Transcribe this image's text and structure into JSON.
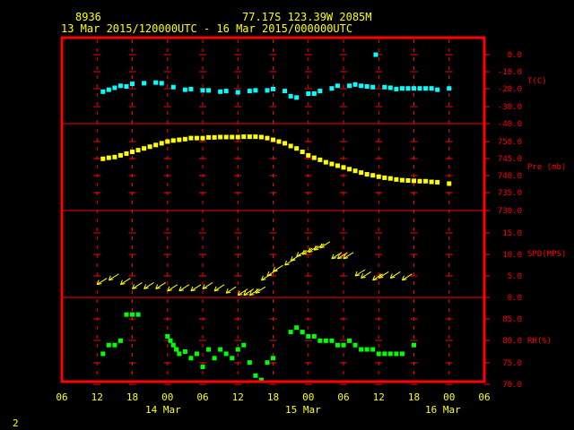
{
  "header": {
    "station_id": "8936",
    "location": "77.17S  123.39W  2085M",
    "time_range": "13 Mar 2015/120000UTC - 16 Mar 2015/000000UTC"
  },
  "page_number": "2",
  "colors": {
    "background": "#000000",
    "frame": "#ff0000",
    "header_text": "#ffff00",
    "temperature": "#00ffff",
    "pressure": "#ffff00",
    "wind": "#ffff00",
    "rh": "#00ff00"
  },
  "x_axis": {
    "tick_labels": [
      "06",
      "12",
      "18",
      "00",
      "06",
      "12",
      "18",
      "00",
      "06",
      "12",
      "18",
      "00",
      "06"
    ],
    "date_labels": [
      "14 Mar",
      "15 Mar",
      "16 Mar"
    ],
    "range_hours": [
      -6,
      66
    ],
    "note_origin": "13 Mar 2015 12UTC = hour 0"
  },
  "chart_data": [
    {
      "type": "scatter",
      "panel": "temperature",
      "ylabel": "T(C)",
      "yticks": [
        "0.0",
        "-10.0",
        "-20.0",
        "-30.0",
        "-40.0"
      ],
      "ylim": [
        -40,
        5
      ],
      "points": [
        {
          "x": 1,
          "y": -28.5
        },
        {
          "x": 2,
          "y": -27
        },
        {
          "x": 3,
          "y": -25.5
        },
        {
          "x": 4,
          "y": -24
        },
        {
          "x": 5,
          "y": -24.5
        },
        {
          "x": 6,
          "y": -22.5
        },
        {
          "x": 8,
          "y": -22
        },
        {
          "x": 10,
          "y": -21.5
        },
        {
          "x": 11,
          "y": -22
        },
        {
          "x": 13,
          "y": -25
        },
        {
          "x": 15,
          "y": -27
        },
        {
          "x": 16,
          "y": -26.5
        },
        {
          "x": 18,
          "y": -27.5
        },
        {
          "x": 19,
          "y": -27.5
        },
        {
          "x": 21,
          "y": -28.5
        },
        {
          "x": 22,
          "y": -28
        },
        {
          "x": 24,
          "y": -29
        },
        {
          "x": 26,
          "y": -28
        },
        {
          "x": 27,
          "y": -27.5
        },
        {
          "x": 29,
          "y": -27.5
        },
        {
          "x": 30,
          "y": -26.5
        },
        {
          "x": 32,
          "y": -28
        },
        {
          "x": 33,
          "y": -32
        },
        {
          "x": 34,
          "y": -33
        },
        {
          "x": 36,
          "y": -30
        },
        {
          "x": 37,
          "y": -30
        },
        {
          "x": 38,
          "y": -28
        },
        {
          "x": 40,
          "y": -26
        },
        {
          "x": 41,
          "y": -24
        },
        {
          "x": 43,
          "y": -24
        },
        {
          "x": 44,
          "y": -23
        },
        {
          "x": 45,
          "y": -24
        },
        {
          "x": 46,
          "y": -24.5
        },
        {
          "x": 47,
          "y": -25
        },
        {
          "x": 49,
          "y": -25
        },
        {
          "x": 50,
          "y": -25.5
        },
        {
          "x": 51,
          "y": -26.5
        },
        {
          "x": 52,
          "y": -26
        },
        {
          "x": 53,
          "y": -26
        },
        {
          "x": 54,
          "y": -26
        },
        {
          "x": 55,
          "y": -26
        },
        {
          "x": 56,
          "y": -26
        },
        {
          "x": 57,
          "y": -26
        },
        {
          "x": 58,
          "y": -27
        },
        {
          "x": 60,
          "y": -26
        },
        {
          "x": 47.5,
          "y": 0
        }
      ]
    },
    {
      "type": "scatter",
      "panel": "pressure",
      "ylabel": "Pre (mb)",
      "yticks": [
        "750.0",
        "745.0",
        "740.0",
        "735.0",
        "730.0"
      ],
      "ylim": [
        730,
        752.5
      ],
      "points": [
        {
          "x": 1,
          "y": 745
        },
        {
          "x": 2,
          "y": 745.3
        },
        {
          "x": 3,
          "y": 745.5
        },
        {
          "x": 4,
          "y": 746
        },
        {
          "x": 5,
          "y": 746.5
        },
        {
          "x": 6,
          "y": 747
        },
        {
          "x": 7,
          "y": 747.5
        },
        {
          "x": 8,
          "y": 748
        },
        {
          "x": 9,
          "y": 748.5
        },
        {
          "x": 10,
          "y": 749
        },
        {
          "x": 11,
          "y": 749.5
        },
        {
          "x": 12,
          "y": 750
        },
        {
          "x": 13,
          "y": 750.3
        },
        {
          "x": 14,
          "y": 750.5
        },
        {
          "x": 15,
          "y": 750.7
        },
        {
          "x": 16,
          "y": 751
        },
        {
          "x": 17,
          "y": 751
        },
        {
          "x": 18,
          "y": 751
        },
        {
          "x": 19,
          "y": 751.2
        },
        {
          "x": 20,
          "y": 751.2
        },
        {
          "x": 21,
          "y": 751.3
        },
        {
          "x": 22,
          "y": 751.3
        },
        {
          "x": 23,
          "y": 751.3
        },
        {
          "x": 24,
          "y": 751.3
        },
        {
          "x": 25,
          "y": 751.4
        },
        {
          "x": 26,
          "y": 751.4
        },
        {
          "x": 27,
          "y": 751.4
        },
        {
          "x": 28,
          "y": 751.3
        },
        {
          "x": 29,
          "y": 751
        },
        {
          "x": 30,
          "y": 750.5
        },
        {
          "x": 31,
          "y": 750
        },
        {
          "x": 32,
          "y": 749.5
        },
        {
          "x": 33,
          "y": 748.7
        },
        {
          "x": 34,
          "y": 748
        },
        {
          "x": 35,
          "y": 747
        },
        {
          "x": 36,
          "y": 746
        },
        {
          "x": 37,
          "y": 745.3
        },
        {
          "x": 38,
          "y": 744.7
        },
        {
          "x": 39,
          "y": 744
        },
        {
          "x": 40,
          "y": 743.5
        },
        {
          "x": 41,
          "y": 743
        },
        {
          "x": 42,
          "y": 742.5
        },
        {
          "x": 43,
          "y": 742
        },
        {
          "x": 44,
          "y": 741.5
        },
        {
          "x": 45,
          "y": 741
        },
        {
          "x": 46,
          "y": 740.5
        },
        {
          "x": 47,
          "y": 740.2
        },
        {
          "x": 48,
          "y": 739.8
        },
        {
          "x": 49,
          "y": 739.5
        },
        {
          "x": 50,
          "y": 739.3
        },
        {
          "x": 51,
          "y": 739
        },
        {
          "x": 52,
          "y": 738.8
        },
        {
          "x": 53,
          "y": 738.7
        },
        {
          "x": 54,
          "y": 738.6
        },
        {
          "x": 55,
          "y": 738.5
        },
        {
          "x": 56,
          "y": 738.5
        },
        {
          "x": 57,
          "y": 738.3
        },
        {
          "x": 58,
          "y": 738.2
        },
        {
          "x": 60,
          "y": 737.8
        }
      ]
    },
    {
      "type": "scatter",
      "panel": "wind",
      "ylabel": "SPD(MPS)",
      "yticks": [
        "15.0",
        "10.0",
        "5.0",
        "0.0"
      ],
      "ylim": [
        0,
        17.5
      ],
      "points": [
        {
          "x": 0,
          "y": 3
        },
        {
          "x": 2,
          "y": 4
        },
        {
          "x": 4,
          "y": 3
        },
        {
          "x": 6,
          "y": 2
        },
        {
          "x": 8,
          "y": 2
        },
        {
          "x": 10,
          "y": 2
        },
        {
          "x": 12,
          "y": 1.5
        },
        {
          "x": 14,
          "y": 1.5
        },
        {
          "x": 16,
          "y": 1.5
        },
        {
          "x": 18,
          "y": 2
        },
        {
          "x": 20,
          "y": 1.5
        },
        {
          "x": 22,
          "y": 1
        },
        {
          "x": 24,
          "y": 0.5
        },
        {
          "x": 25,
          "y": 0.5
        },
        {
          "x": 26,
          "y": 0.5
        },
        {
          "x": 27,
          "y": 1
        },
        {
          "x": 28,
          "y": 4
        },
        {
          "x": 29,
          "y": 5
        },
        {
          "x": 30,
          "y": 6
        },
        {
          "x": 32,
          "y": 7.5
        },
        {
          "x": 33,
          "y": 8.5
        },
        {
          "x": 34,
          "y": 9.5
        },
        {
          "x": 35,
          "y": 10
        },
        {
          "x": 36,
          "y": 10.5
        },
        {
          "x": 37,
          "y": 11
        },
        {
          "x": 38,
          "y": 11.5
        },
        {
          "x": 40,
          "y": 9
        },
        {
          "x": 41,
          "y": 9
        },
        {
          "x": 42,
          "y": 9
        },
        {
          "x": 44,
          "y": 5
        },
        {
          "x": 45,
          "y": 4.5
        },
        {
          "x": 47,
          "y": 4
        },
        {
          "x": 48,
          "y": 4.5
        },
        {
          "x": 50,
          "y": 4.5
        },
        {
          "x": 52,
          "y": 4
        }
      ]
    },
    {
      "type": "scatter",
      "panel": "relative_humidity",
      "ylabel": "RH(%)",
      "yticks": [
        "85.0",
        "80.0",
        "75.0",
        "70.0"
      ],
      "ylim": [
        70,
        88
      ],
      "points": [
        {
          "x": 1,
          "y": 77
        },
        {
          "x": 2,
          "y": 79
        },
        {
          "x": 3,
          "y": 79
        },
        {
          "x": 4,
          "y": 80
        },
        {
          "x": 5,
          "y": 86
        },
        {
          "x": 6,
          "y": 86
        },
        {
          "x": 7,
          "y": 86
        },
        {
          "x": 12,
          "y": 81
        },
        {
          "x": 12.5,
          "y": 80
        },
        {
          "x": 13,
          "y": 79
        },
        {
          "x": 13.5,
          "y": 78
        },
        {
          "x": 14,
          "y": 77
        },
        {
          "x": 15,
          "y": 77.5
        },
        {
          "x": 16,
          "y": 76
        },
        {
          "x": 17,
          "y": 77
        },
        {
          "x": 18,
          "y": 74
        },
        {
          "x": 19,
          "y": 78
        },
        {
          "x": 20,
          "y": 76
        },
        {
          "x": 21,
          "y": 78
        },
        {
          "x": 22,
          "y": 77
        },
        {
          "x": 23,
          "y": 76
        },
        {
          "x": 24,
          "y": 78
        },
        {
          "x": 25,
          "y": 79
        },
        {
          "x": 26,
          "y": 75
        },
        {
          "x": 27,
          "y": 72
        },
        {
          "x": 28,
          "y": 71
        },
        {
          "x": 29,
          "y": 75
        },
        {
          "x": 30,
          "y": 76
        },
        {
          "x": 33,
          "y": 82
        },
        {
          "x": 34,
          "y": 83
        },
        {
          "x": 35,
          "y": 82
        },
        {
          "x": 36,
          "y": 81
        },
        {
          "x": 37,
          "y": 81
        },
        {
          "x": 38,
          "y": 80
        },
        {
          "x": 39,
          "y": 80
        },
        {
          "x": 40,
          "y": 80
        },
        {
          "x": 41,
          "y": 79
        },
        {
          "x": 42,
          "y": 79
        },
        {
          "x": 43,
          "y": 80
        },
        {
          "x": 44,
          "y": 79
        },
        {
          "x": 45,
          "y": 78
        },
        {
          "x": 46,
          "y": 78
        },
        {
          "x": 47,
          "y": 78
        },
        {
          "x": 48,
          "y": 77
        },
        {
          "x": 49,
          "y": 77
        },
        {
          "x": 50,
          "y": 77
        },
        {
          "x": 51,
          "y": 77
        },
        {
          "x": 52,
          "y": 77
        },
        {
          "x": 54,
          "y": 79
        }
      ]
    }
  ]
}
